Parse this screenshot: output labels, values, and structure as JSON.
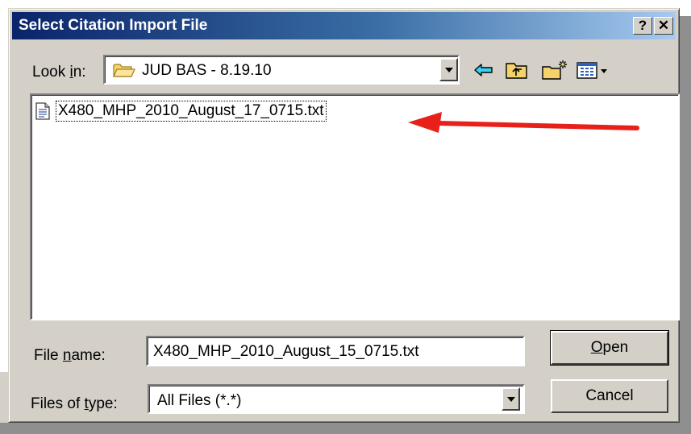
{
  "window": {
    "title": "Select Citation Import File"
  },
  "titlebar": {
    "help": "?",
    "close": "✕"
  },
  "lookin": {
    "label_pre": "Look ",
    "label_key": "i",
    "label_post": "n:",
    "value": "JUD BAS - 8.19.10"
  },
  "toolbar": {
    "icons": [
      "back-icon",
      "up-folder-icon",
      "new-folder-icon",
      "views-menu-icon"
    ]
  },
  "files": [
    {
      "name": "X480_MHP_2010_August_17_0715.txt",
      "icon": "text-document-icon"
    }
  ],
  "annotation": {
    "arrow_color": "#e8201a"
  },
  "filename": {
    "label_pre": "File ",
    "label_key": "n",
    "label_post": "ame:",
    "value": "X480_MHP_2010_August_15_0715.txt"
  },
  "filetype": {
    "label_pre": "Files of ",
    "label_key": "t",
    "label_post": "ype:",
    "value": "All Files (*.*)"
  },
  "buttons": {
    "open_key": "O",
    "open_rest": "pen",
    "cancel": "Cancel"
  }
}
